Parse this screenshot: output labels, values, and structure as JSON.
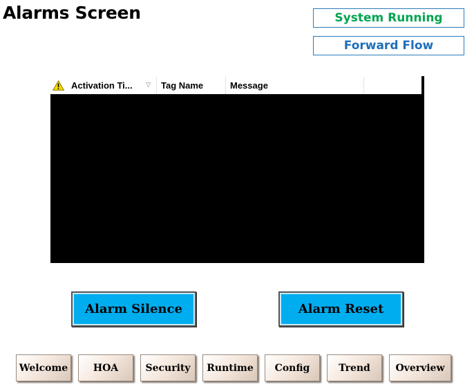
{
  "page": {
    "title": "Alarms Screen"
  },
  "status": {
    "system": {
      "label": "System Running",
      "color": "#00a550"
    },
    "flow": {
      "label": "Forward Flow",
      "color": "#1e6fba"
    }
  },
  "alarm_table": {
    "columns": [
      {
        "label": "",
        "icon": "warning-icon"
      },
      {
        "label": "Activation Ti...",
        "sort": "descending"
      },
      {
        "label": "Tag Name"
      },
      {
        "label": "Message"
      },
      {
        "label": ""
      }
    ],
    "rows": []
  },
  "buttons": {
    "silence": "Alarm Silence",
    "reset": "Alarm Reset",
    "accent": "#00adef"
  },
  "nav": {
    "welcome": "Welcome",
    "hoa": "HOA",
    "security": "Security",
    "runtime": "Runtime",
    "config": "Config",
    "trend": "Trend",
    "overview": "Overview"
  }
}
